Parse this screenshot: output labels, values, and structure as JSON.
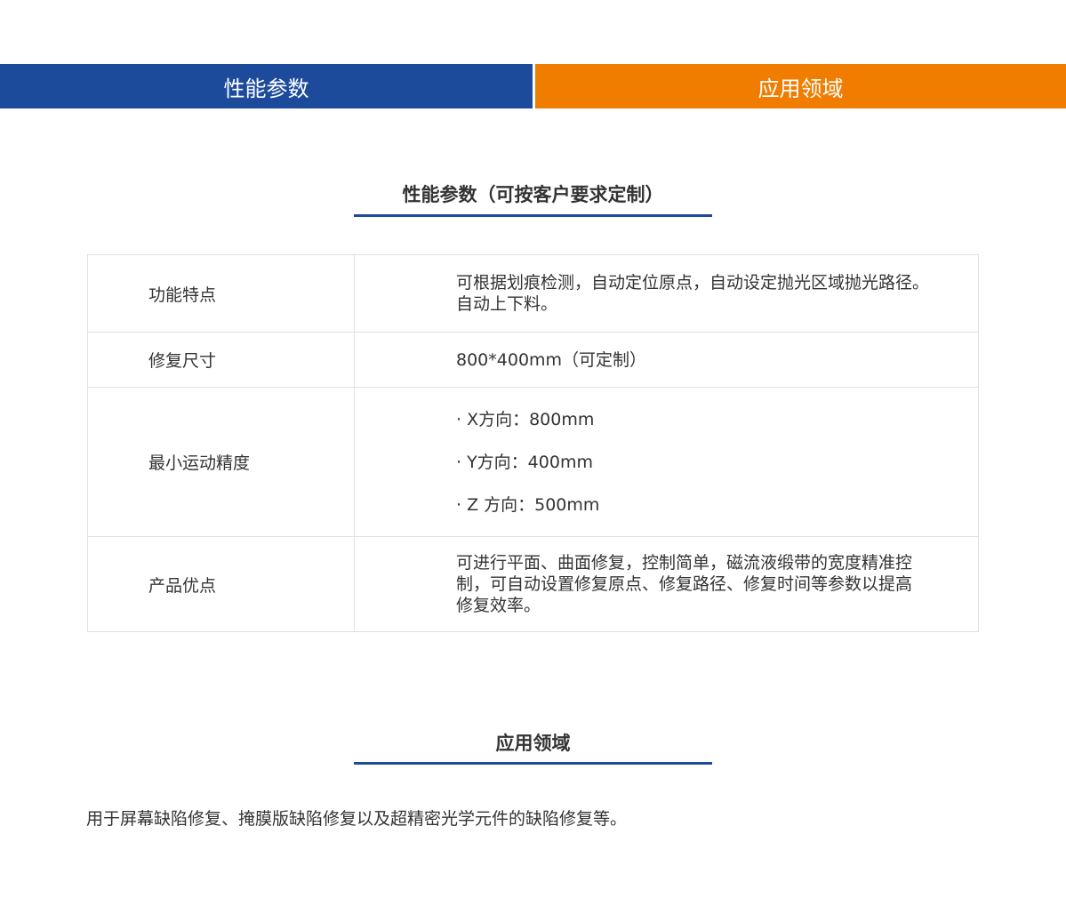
{
  "tabs": {
    "params_label": "性能参数",
    "apps_label": "应用领域"
  },
  "colors": {
    "blue": "#1c4b9c",
    "orange": "#f07d00"
  },
  "params_section": {
    "title": "性能参数（可按客户要求定制）",
    "rows": [
      {
        "label": "功能特点",
        "value_lines": [
          "可根据划痕检测，自动定位原点，自动设定抛光区域抛光路径。",
          "自动上下料。"
        ]
      },
      {
        "label": "修复尺寸",
        "value_lines": [
          "800*400mm（可定制）"
        ]
      },
      {
        "label": "最小运动精度",
        "value_lines": [
          "· X方向：800mm",
          "· Y方向：400mm",
          "· Z 方向：500mm"
        ]
      },
      {
        "label": "产品优点",
        "value_lines": [
          "可进行平面、曲面修复，控制简单，磁流液缎带的宽度精准控",
          "制，可自动设置修复原点、修复路径、修复时间等参数以提高",
          "修复效率。"
        ]
      }
    ]
  },
  "apps_section": {
    "title": "应用领域",
    "text": "用于屏幕缺陷修复、掩膜版缺陷修复以及超精密光学元件的缺陷修复等。"
  }
}
